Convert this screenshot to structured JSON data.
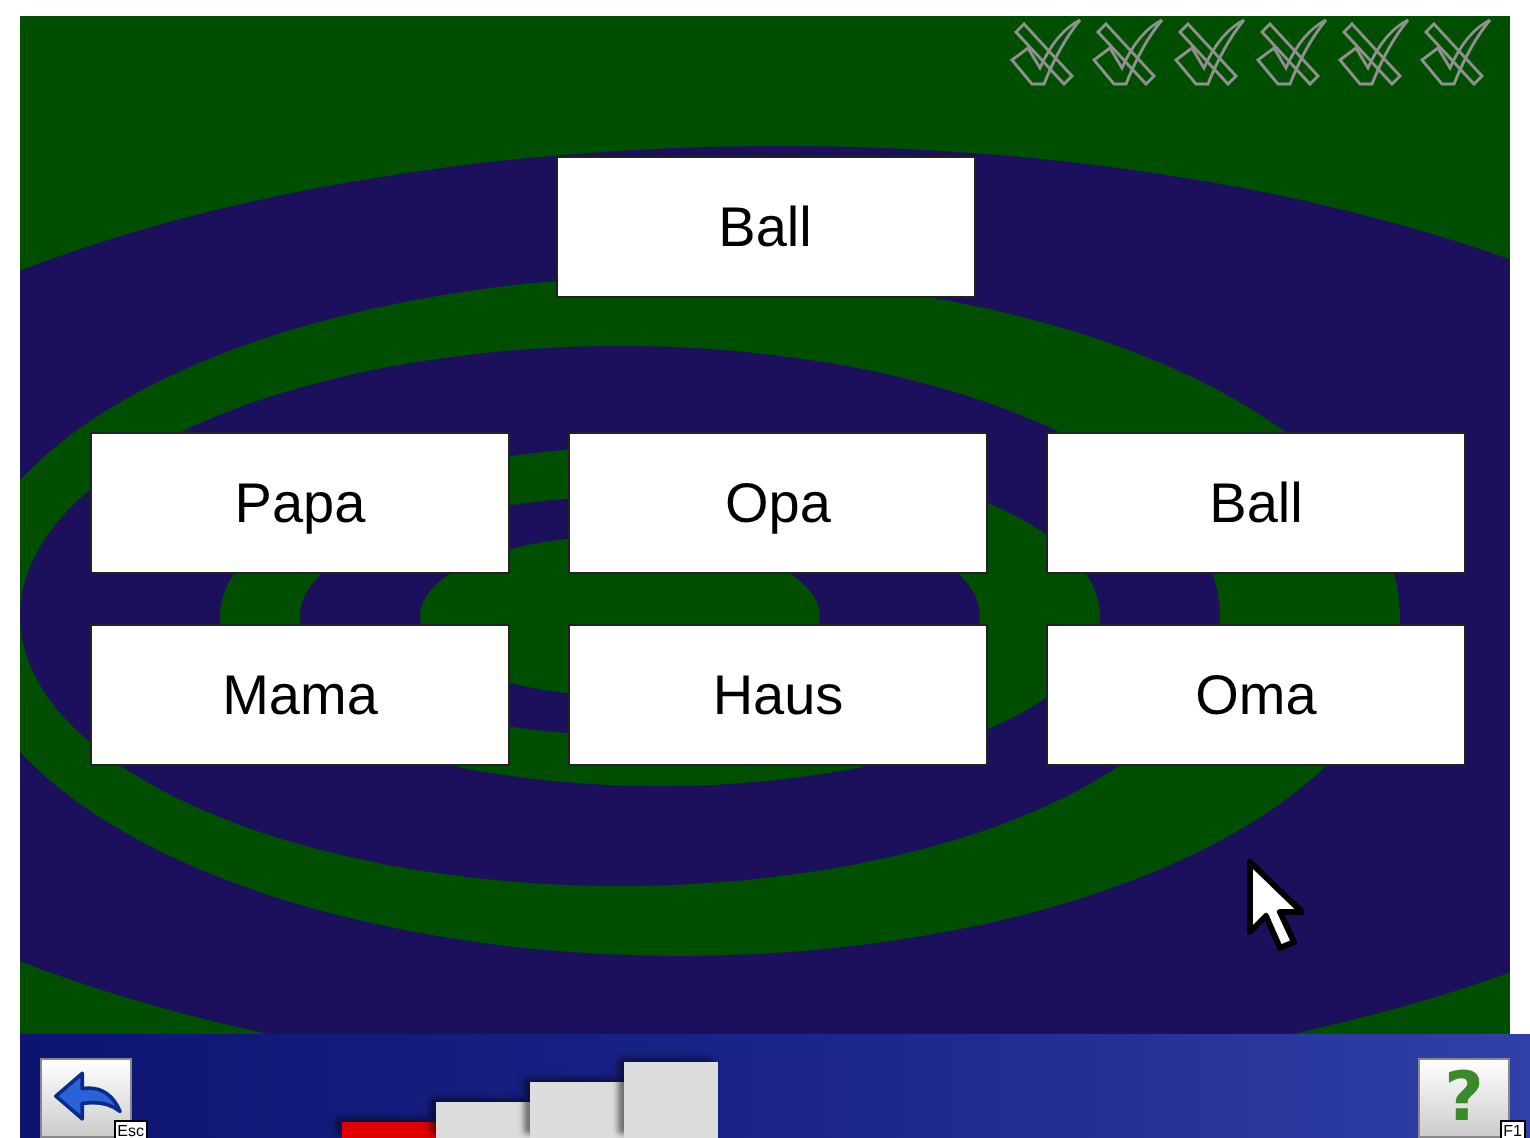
{
  "marks": [
    {
      "earned": false
    },
    {
      "earned": false
    },
    {
      "earned": false
    },
    {
      "earned": false
    },
    {
      "earned": false
    },
    {
      "earned": false
    }
  ],
  "prompt": "Ball",
  "options": [
    "Papa",
    "Opa",
    "Ball",
    "Mama",
    "Haus",
    "Oma"
  ],
  "back_button": {
    "key": "Esc"
  },
  "progress": [
    {
      "done": true
    },
    {
      "done": false
    },
    {
      "done": false
    },
    {
      "done": false
    }
  ],
  "help_button": {
    "label": "?",
    "key": "F1"
  }
}
